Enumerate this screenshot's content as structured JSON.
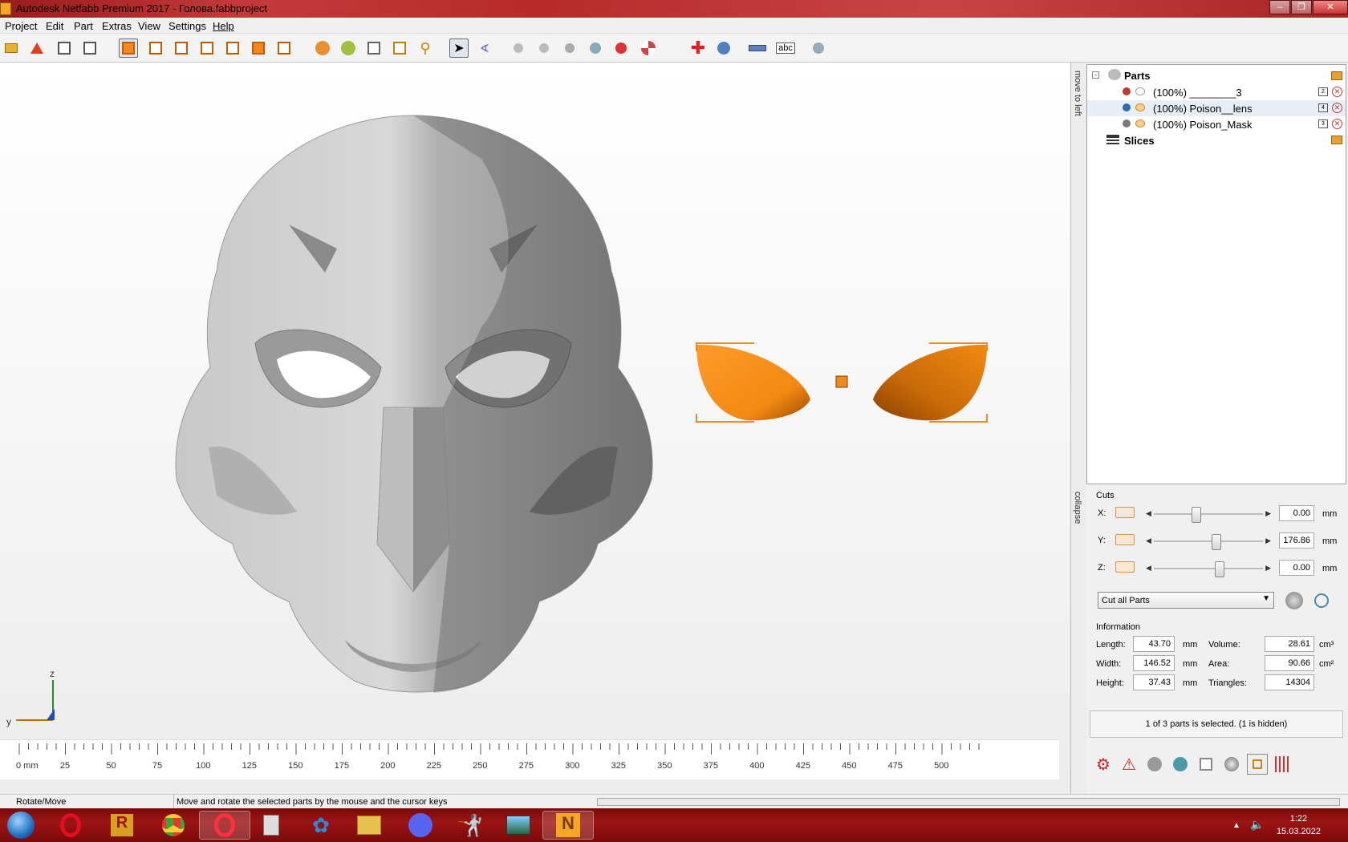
{
  "window": {
    "title": "Autodesk Netfabb Premium 2017 - Голова.fabbproject",
    "controls": [
      "minimize",
      "maximize",
      "close"
    ]
  },
  "menu": [
    "Project",
    "Edit",
    "Part",
    "Extras",
    "View",
    "Settings",
    "Help"
  ],
  "side_tabs": {
    "move_to_left": "move to left",
    "collapse": "collapse"
  },
  "tree": {
    "parts_label": "Parts",
    "slices_label": "Slices",
    "items": [
      {
        "label": "(100%) ________3",
        "index": "2",
        "color": "#c0392b",
        "selected": false
      },
      {
        "label": "(100%) Poison__lens",
        "index": "4",
        "color": "#2c6bb0",
        "selected": true
      },
      {
        "label": "(100%) Poison_Mask",
        "index": "3",
        "color": "#7a7a7a",
        "selected": false
      }
    ]
  },
  "cuts": {
    "title": "Cuts",
    "x": {
      "label": "X:",
      "value": "0.00",
      "unit": "mm",
      "slider_fraction": 0.38
    },
    "y": {
      "label": "Y:",
      "value": "176.86",
      "unit": "mm",
      "slider_fraction": 0.58
    },
    "z": {
      "label": "Z:",
      "value": "0.00",
      "unit": "mm",
      "slider_fraction": 0.61
    },
    "mode": "Cut all Parts"
  },
  "information": {
    "title": "Information",
    "length": {
      "label": "Length:",
      "value": "43.70",
      "unit": "mm"
    },
    "width": {
      "label": "Width:",
      "value": "146.52",
      "unit": "mm"
    },
    "height": {
      "label": "Height:",
      "value": "37.43",
      "unit": "mm"
    },
    "volume": {
      "label": "Volume:",
      "value": "28.61",
      "unit": "cm³"
    },
    "area": {
      "label": "Area:",
      "value": "90.66",
      "unit": "cm²"
    },
    "triangles": {
      "label": "Triangles:",
      "value": "14304"
    }
  },
  "selection_status": "1 of 3 parts is selected. (1 is hidden)",
  "ruler": {
    "unit_label": "0 mm",
    "labels": [
      "25",
      "50",
      "75",
      "100",
      "125",
      "150",
      "175",
      "200",
      "225",
      "250",
      "275",
      "300",
      "325",
      "350",
      "375",
      "400",
      "425",
      "450",
      "475",
      "500"
    ]
  },
  "axis": {
    "z": "z",
    "y": "y"
  },
  "statusbar": {
    "mode": "Rotate/Move",
    "hint": "Move and rotate the selected parts by the mouse and the cursor keys"
  },
  "taskbar": {
    "apps": [
      "start-orb",
      "opera",
      "rapid",
      "chrome",
      "opera-gx",
      "calculator",
      "network",
      "explorer",
      "discord",
      "zbrush",
      "photos",
      "netfabb"
    ],
    "time": "1:22",
    "date": "15.03.2022"
  },
  "colors": {
    "accent_orange": "#f08a1c",
    "titlebar": "#b82a2a",
    "mask_gray": "#b5b5b5"
  }
}
